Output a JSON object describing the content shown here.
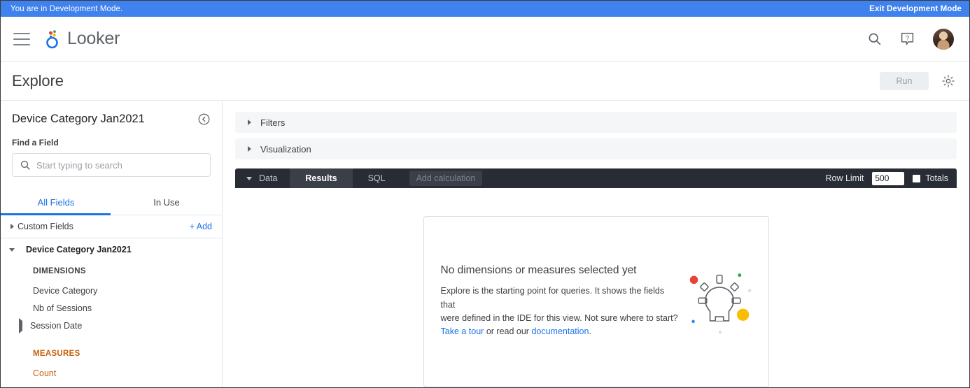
{
  "dev_banner": {
    "message": "You are in Development Mode.",
    "exit_label": "Exit Development Mode",
    "color": "#3f81ed"
  },
  "header": {
    "brand": "Looker",
    "menu_icon": "hamburger-icon",
    "search_icon": "search-icon",
    "help_icon": "help-icon",
    "avatar": "user-avatar"
  },
  "explore_bar": {
    "title": "Explore",
    "run_label": "Run",
    "settings_icon": "gear-icon"
  },
  "sidebar": {
    "view_title": "Device Category Jan2021",
    "collapse_icon": "collapse-left-icon",
    "find_label": "Find a Field",
    "search_placeholder": "Start typing to search",
    "search_value": "",
    "tabs": [
      {
        "label": "All Fields",
        "active": true
      },
      {
        "label": "In Use",
        "active": false
      }
    ],
    "custom_fields": {
      "label": "Custom Fields",
      "add_label": "+ Add"
    },
    "view": {
      "name": "Device Category Jan2021",
      "groups": [
        {
          "label": "DIMENSIONS",
          "color": "#3c4043",
          "fields": [
            {
              "label": "Device Category",
              "expandable": false
            },
            {
              "label": "Nb of Sessions",
              "expandable": false
            },
            {
              "label": "Session Date",
              "expandable": true
            }
          ]
        },
        {
          "label": "MEASURES",
          "color": "#c7600a",
          "fields": [
            {
              "label": "Count",
              "expandable": false
            }
          ]
        }
      ]
    }
  },
  "main": {
    "accordions": [
      {
        "label": "Filters"
      },
      {
        "label": "Visualization"
      }
    ],
    "toolbar": {
      "data_label": "Data",
      "tabs": [
        {
          "label": "Results",
          "active": true
        },
        {
          "label": "SQL",
          "active": false
        }
      ],
      "add_calculation_label": "Add calculation",
      "row_limit_label": "Row Limit",
      "row_limit_value": "500",
      "totals_label": "Totals",
      "totals_checked": false
    },
    "empty_state": {
      "title": "No dimensions or measures selected yet",
      "body_line1": "Explore is the starting point for queries. It shows the fields that",
      "body_line2": "were defined in the IDE for this view. Not sure where to start?",
      "tour_link": "Take a tour",
      "body_mid": " or read our ",
      "doc_link": "documentation",
      "body_end": ".",
      "illustration": "lightbulb-illustration"
    }
  },
  "colors": {
    "accent_blue": "#1a73e8",
    "banner_blue": "#3f81ed",
    "measure_orange": "#c7600a",
    "google_red": "#ea4335",
    "google_yellow": "#fbbc04",
    "google_green": "#34a853",
    "toolbar_dark": "#282c34"
  }
}
